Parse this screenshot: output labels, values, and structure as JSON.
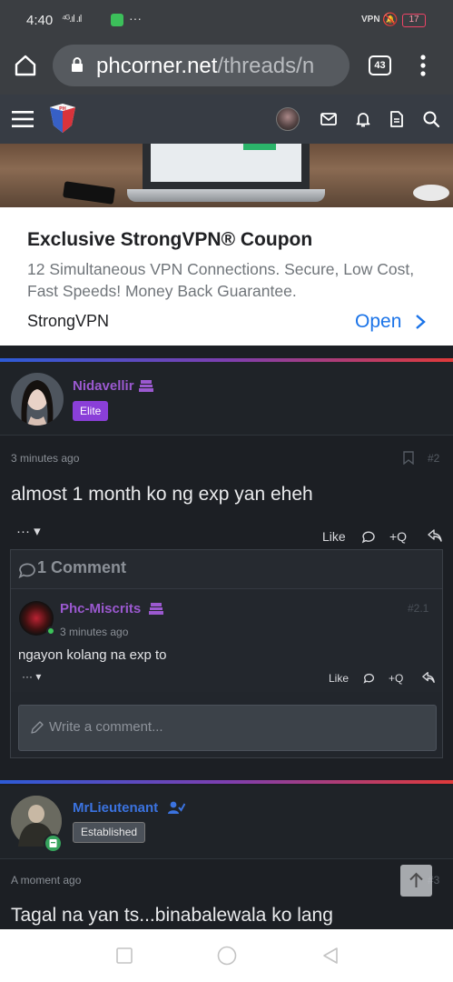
{
  "status_bar": {
    "time": "4:40",
    "signal_text": "⁴ᴳ.ıl .ıl",
    "more": "···",
    "vpn": "VPN",
    "battery": "17"
  },
  "browser": {
    "url_host": "phcorner.net",
    "url_path": "/threads/n",
    "tab_count": "43"
  },
  "ad": {
    "title": "Exclusive StrongVPN® Coupon",
    "description": "12 Simultaneous VPN Connections. Secure, Low Cost, Fast Speeds! Money Back Guarantee.",
    "brand": "StrongVPN",
    "cta": "Open"
  },
  "post1": {
    "username": "Nidavellir",
    "user_badge": "Elite",
    "time": "3 minutes ago",
    "post_number": "#2",
    "body": "almost 1 month ko ng exp yan eheh",
    "actions": {
      "more": "···",
      "like": "Like",
      "quote": "+Q"
    },
    "comments": {
      "title": "1 Comment",
      "items": [
        {
          "username": "Phc-Miscrits",
          "time": "3 minutes ago",
          "number": "#2.1",
          "body": "ngayon kolang na exp to",
          "actions": {
            "more": "···",
            "like": "Like",
            "quote": "+Q"
          }
        }
      ],
      "write_placeholder": "Write a comment..."
    }
  },
  "post2": {
    "username": "MrLieutenant",
    "user_badge": "Established",
    "time": "A moment ago",
    "post_number": "#3",
    "body": "Tagal na yan ts...binabalewala ko lang"
  },
  "colors": {
    "status_bg": "#3b3e42",
    "header_bg": "#373c44",
    "page_bg": "#1c1f24",
    "username_purple": "#9b59d0",
    "username_blue": "#3b73e0",
    "elite_badge": "#8a3fd8",
    "ad_link": "#1a73e8",
    "online": "#3cc35a"
  },
  "icons": [
    "home-icon",
    "lock-icon",
    "tabs-icon",
    "kebab-icon",
    "hamburger-icon",
    "site-logo",
    "mail-icon",
    "bell-icon",
    "document-icon",
    "search-icon",
    "bookmark-icon",
    "comment-icon",
    "share-icon",
    "pencil-icon",
    "arrow-up-icon",
    "nav-recent-icon",
    "nav-home-icon",
    "nav-back-icon"
  ]
}
